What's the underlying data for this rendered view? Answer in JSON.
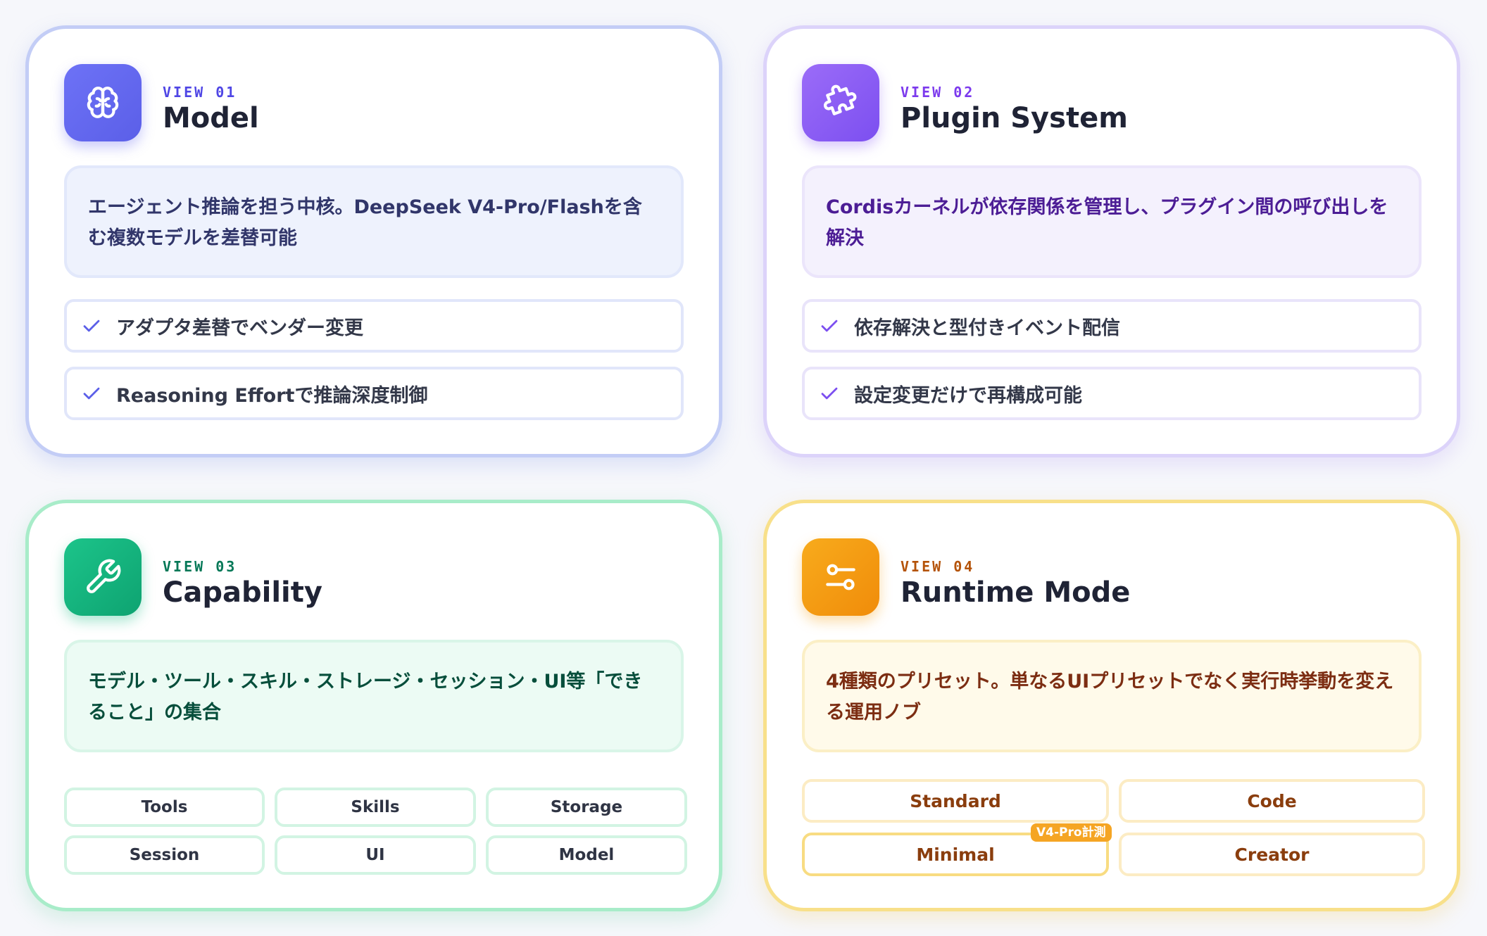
{
  "cards": [
    {
      "view": "VIEW 01",
      "title": "Model",
      "icon": "brain-icon",
      "accent": "#6366f1",
      "description": "エージェント推論を担う中核。DeepSeek V4-Pro/Flashを含む複数モデルを差替可能",
      "features": [
        "アダプタ差替でベンダー変更",
        "Reasoning Effortで推論深度制御"
      ]
    },
    {
      "view": "VIEW 02",
      "title": "Plugin System",
      "icon": "puzzle-icon",
      "accent": "#8b5cf6",
      "description": "Cordisカーネルが依存関係を管理し、プラグイン間の呼び出しを解決",
      "features": [
        "依存解決と型付きイベント配信",
        "設定変更だけで再構成可能"
      ]
    },
    {
      "view": "VIEW 03",
      "title": "Capability",
      "icon": "wrench-icon",
      "accent": "#10b981",
      "description": "モデル・ツール・スキル・ストレージ・セッション・UI等「できること」の集合",
      "chips": [
        "Tools",
        "Skills",
        "Storage",
        "Session",
        "UI",
        "Model"
      ]
    },
    {
      "view": "VIEW 04",
      "title": "Runtime Mode",
      "icon": "sliders-icon",
      "accent": "#f59e0b",
      "description": "4種類のプリセット。単なるUIプリセットでなく実行時挙動を変える運用ノブ",
      "modes": [
        "Standard",
        "Code",
        "Minimal",
        "Creator"
      ],
      "badge": "V4-Pro計測"
    }
  ]
}
